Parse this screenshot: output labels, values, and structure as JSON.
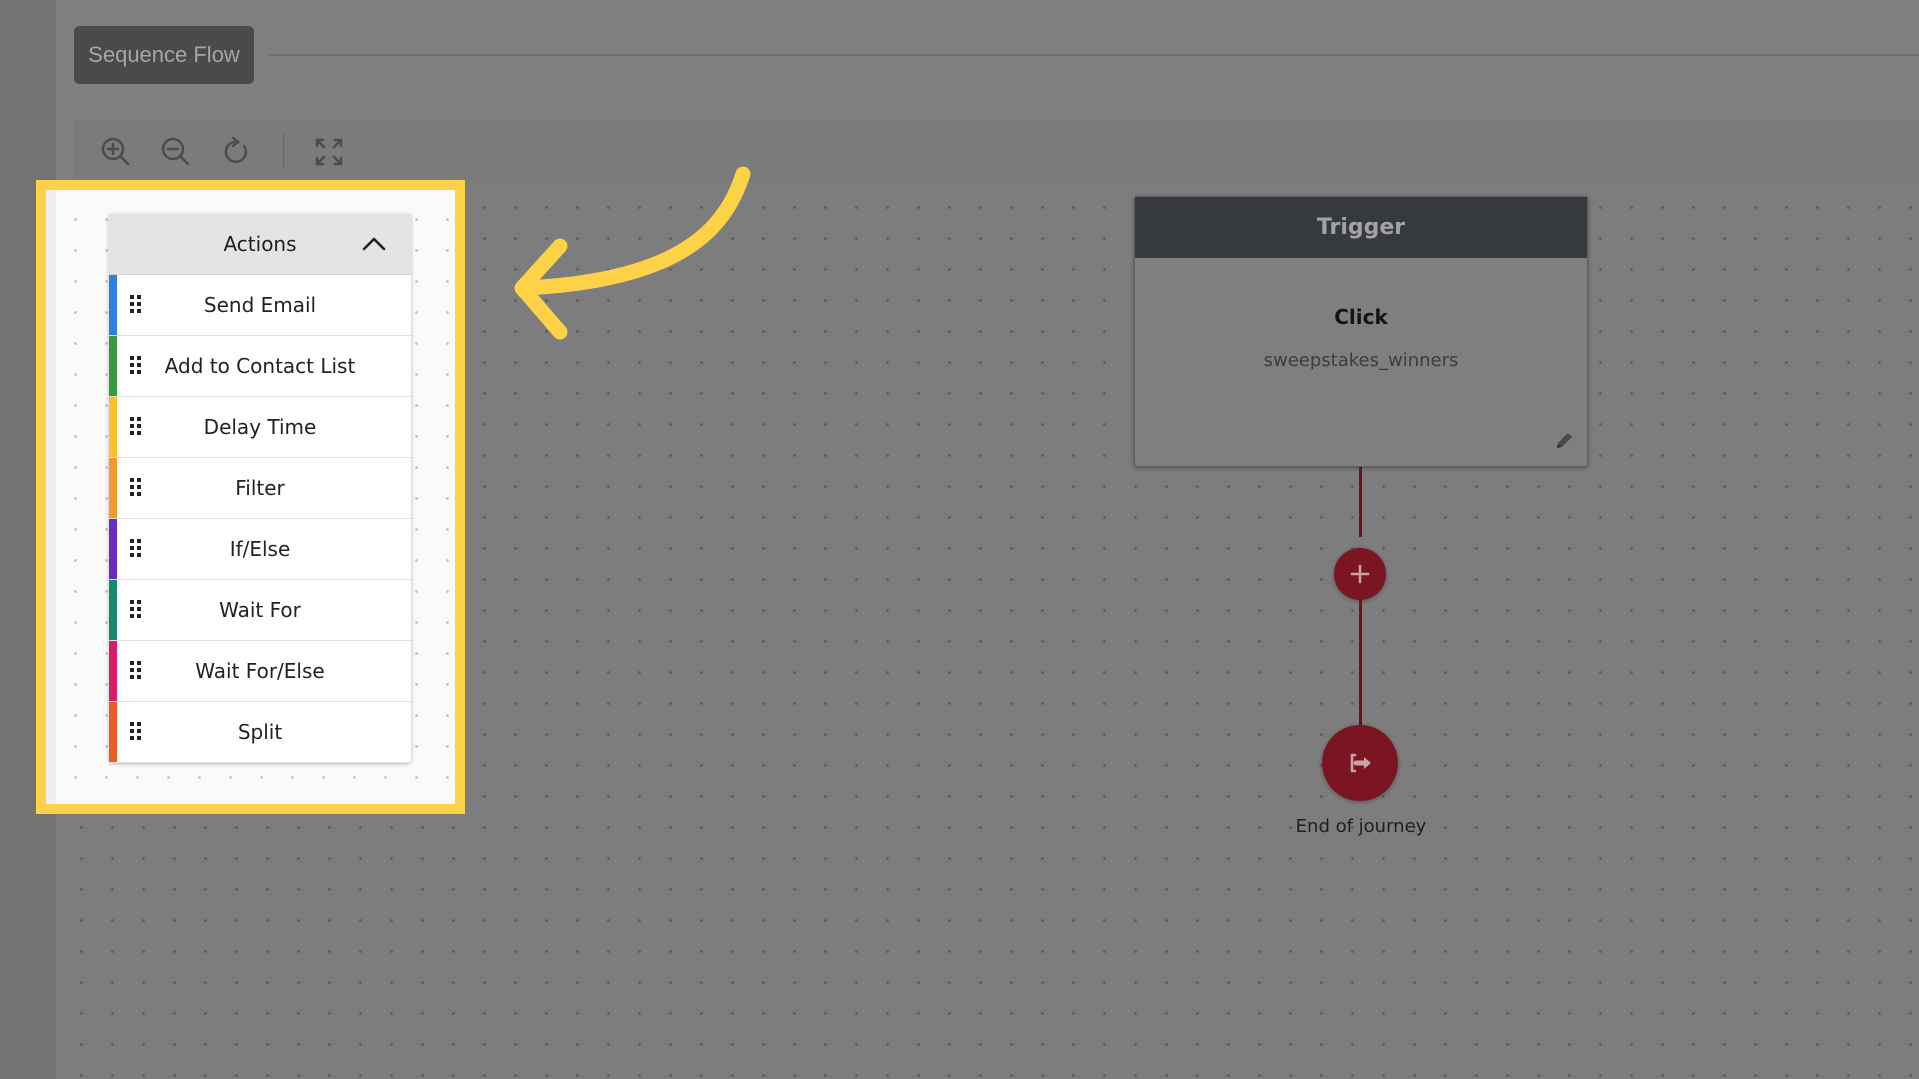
{
  "header": {
    "tab_label": "Sequence Flow"
  },
  "toolbar": {
    "tools": [
      {
        "icon": "zoom-in-icon"
      },
      {
        "icon": "zoom-out-icon"
      },
      {
        "icon": "reset-rotate-icon"
      },
      {
        "icon": "fullscreen-icon"
      }
    ]
  },
  "actions_panel": {
    "title": "Actions",
    "items": [
      {
        "label": "Send Email",
        "color": "#2f7fe0"
      },
      {
        "label": "Add to Contact List",
        "color": "#3a9a3f"
      },
      {
        "label": "Delay Time",
        "color": "#fbc02d"
      },
      {
        "label": "Filter",
        "color": "#f39a2b"
      },
      {
        "label": "If/Else",
        "color": "#6a2bbf"
      },
      {
        "label": "Wait For",
        "color": "#138a6c"
      },
      {
        "label": "Wait For/Else",
        "color": "#d81b6a"
      },
      {
        "label": "Split",
        "color": "#ee5a24"
      }
    ]
  },
  "trigger": {
    "header": "Trigger",
    "event": "Click",
    "name": "sweepstakes_winners"
  },
  "end_node": {
    "label": "End of journey"
  },
  "colors": {
    "highlight": "#fdd247",
    "node": "#7c1522",
    "trigger_header": "#363a3f"
  }
}
